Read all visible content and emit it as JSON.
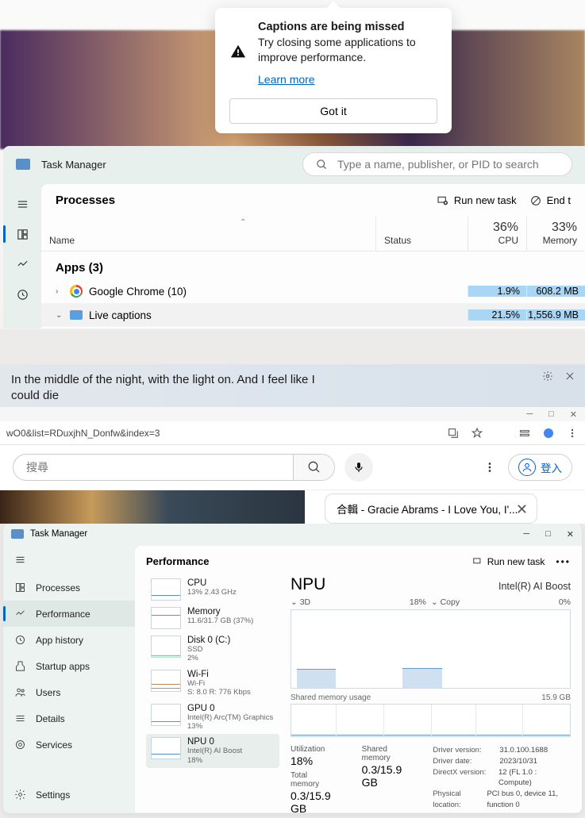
{
  "notification": {
    "title": "Captions are being missed",
    "description": "Try closing some applications to improve performance.",
    "link": "Learn more",
    "button": "Got it"
  },
  "tm1": {
    "app_title": "Task Manager",
    "search_placeholder": "Type a name, publisher, or PID to search",
    "page_title": "Processes",
    "run_new_task": "Run new task",
    "end_task": "End t",
    "columns": {
      "name": "Name",
      "status": "Status",
      "cpu": "CPU",
      "memory": "Memory"
    },
    "summary": {
      "cpu": "36%",
      "memory": "33%"
    },
    "group": "Apps (3)",
    "rows": [
      {
        "chev": "›",
        "name": "Google Chrome (10)",
        "cpu": "1.9%",
        "memory": "608.2 MB"
      },
      {
        "chev": "⌄",
        "name": "Live captions",
        "cpu": "21.5%",
        "memory": "1,556.9 MB"
      }
    ]
  },
  "caption": {
    "text": "In the middle of the night, with the light on. And I feel like I could die"
  },
  "browser": {
    "address": "wO0&list=RDuxjhN_Donfw&index=3",
    "search_placeholder": "搜尋",
    "login": "登入",
    "card_title": "合輯 - Gracie Abrams - I Love You, I'..."
  },
  "tm2": {
    "app_title": "Task Manager",
    "nav": {
      "processes": "Processes",
      "performance": "Performance",
      "app_history": "App history",
      "startup": "Startup apps",
      "users": "Users",
      "details": "Details",
      "services": "Services",
      "settings": "Settings"
    },
    "page_title": "Performance",
    "run_new_task": "Run new task",
    "perf_items": {
      "cpu": {
        "name": "CPU",
        "sub": "13%  2.43 GHz"
      },
      "memory": {
        "name": "Memory",
        "sub": "11.6/31.7 GB (37%)"
      },
      "disk": {
        "name": "Disk 0 (C:)",
        "sub1": "SSD",
        "sub2": "2%"
      },
      "wifi": {
        "name": "Wi-Fi",
        "sub1": "Wi-Fi",
        "sub2": "S: 8.0  R: 776 Kbps"
      },
      "gpu": {
        "name": "GPU 0",
        "sub1": "Intel(R) Arc(TM) Graphics",
        "sub2": "13%"
      },
      "npu": {
        "name": "NPU 0",
        "sub1": "Intel(R) AI Boost",
        "sub2": "18%"
      }
    },
    "npu": {
      "title": "NPU",
      "subtitle": "Intel(R) AI Boost",
      "view_3d": "3D",
      "view_pct": "18%",
      "copy": "Copy",
      "right_pct": "0%",
      "shm_label": "Shared memory usage",
      "shm_max": "15.9 GB",
      "stats": {
        "util_lbl": "Utilization",
        "util_val": "18%",
        "shm_lbl": "Shared memory",
        "shm_val": "0.3/15.9 GB",
        "tot_lbl": "Total memory",
        "tot_val": "0.3/15.9 GB"
      },
      "driver": {
        "version_k": "Driver version:",
        "version_v": "31.0.100.1688",
        "date_k": "Driver date:",
        "date_v": "2023/10/31",
        "dx_k": "DirectX version:",
        "dx_v": "12 (FL 1.0 : Compute)",
        "loc_k": "Physical location:",
        "loc_v": "PCI bus 0, device 11, function 0"
      }
    }
  },
  "chart_data": [
    {
      "type": "line",
      "title": "NPU 3D utilization",
      "ylabel": "%",
      "ylim": [
        0,
        100
      ],
      "x": [
        0,
        1,
        2,
        3,
        4,
        5,
        6,
        7,
        8,
        9,
        10,
        11,
        12,
        13,
        14,
        15,
        16,
        17,
        18,
        19
      ],
      "values": [
        18,
        20,
        22,
        18,
        0,
        0,
        0,
        0,
        20,
        24,
        22,
        20,
        0,
        0,
        0,
        0,
        0,
        0,
        0,
        0
      ]
    },
    {
      "type": "line",
      "title": "NPU shared memory usage",
      "ylabel": "GB",
      "ylim": [
        0,
        15.9
      ],
      "x": [
        0,
        1,
        2,
        3,
        4,
        5,
        6,
        7,
        8,
        9
      ],
      "values": [
        0.3,
        0.3,
        0.3,
        0.3,
        0.3,
        0.3,
        0.3,
        0.3,
        0.3,
        0.3
      ]
    }
  ]
}
